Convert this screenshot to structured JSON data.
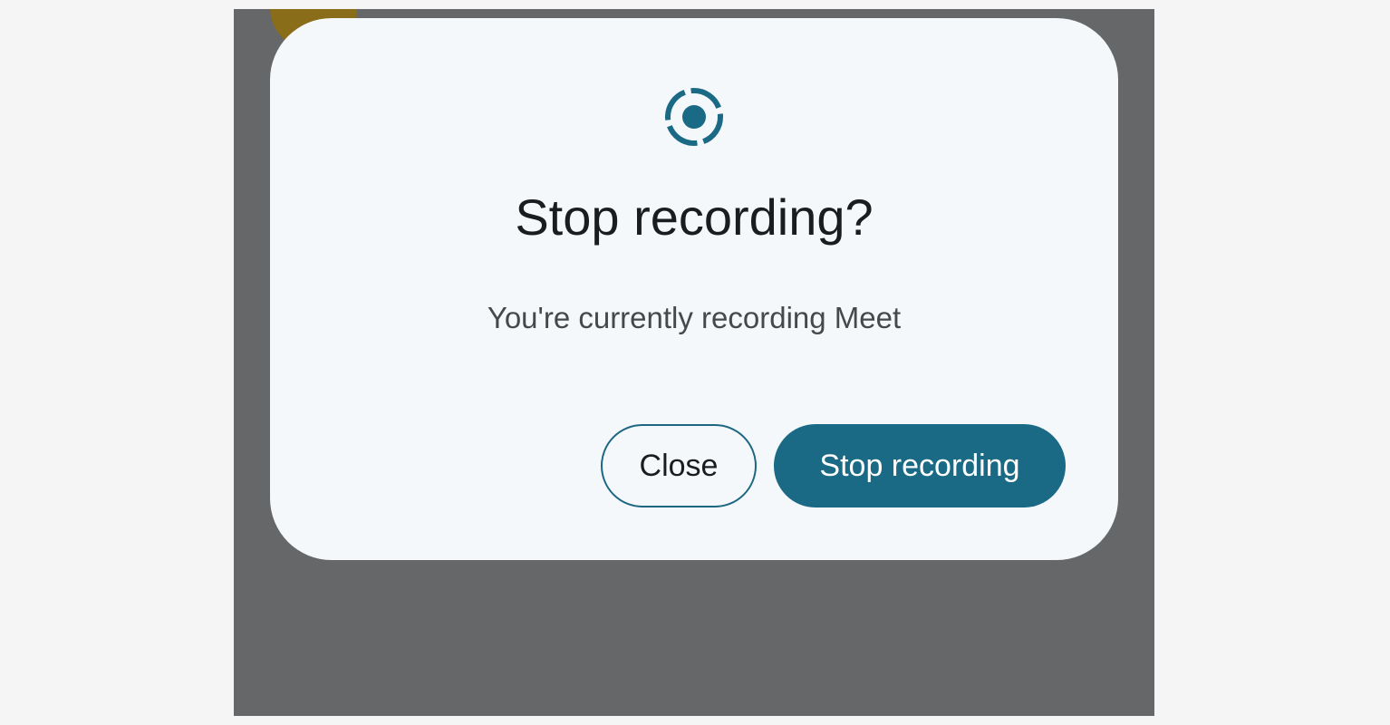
{
  "dialog": {
    "icon": "screen-record-icon",
    "title": "Stop recording?",
    "message": "You're currently recording Meet",
    "close_label": "Close",
    "stop_label": "Stop recording"
  },
  "colors": {
    "accent": "#1b6a85",
    "scrim": "#656769",
    "dialog_background": "#f4f8fb"
  }
}
